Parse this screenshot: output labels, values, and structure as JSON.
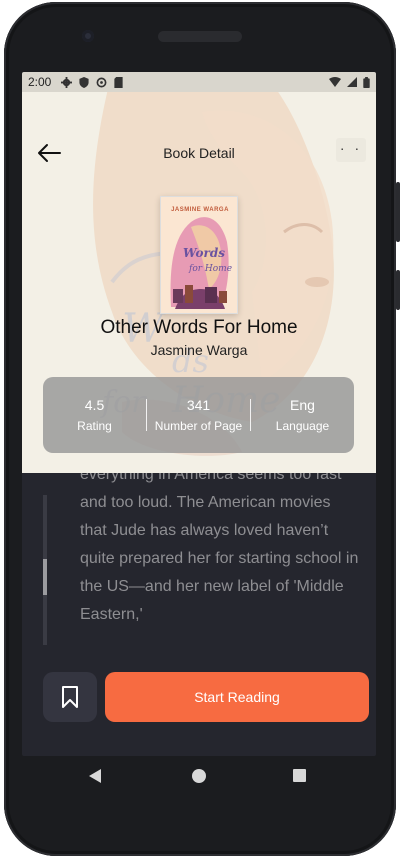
{
  "status_bar": {
    "time": "2:00"
  },
  "header": {
    "title": "Book Detail",
    "more_label": "· ·"
  },
  "book": {
    "cover_author": "JASMINE WARGA",
    "title": "Other Words For Home",
    "author": "Jasmine Warga"
  },
  "stats": [
    {
      "value": "4.5",
      "label": "Rating"
    },
    {
      "value": "341",
      "label": "Number of Page"
    },
    {
      "value": "Eng",
      "label": "Language"
    }
  ],
  "description": "everything in America seems too fast and too loud. The American movies that Jude has always loved haven’t quite prepared her for starting school in the US—and her new label of 'Middle Eastern,'",
  "actions": {
    "start_label": "Start Reading"
  },
  "colors": {
    "accent": "#f76b41",
    "background": "#25262e",
    "hero": "#f3f0e6"
  }
}
